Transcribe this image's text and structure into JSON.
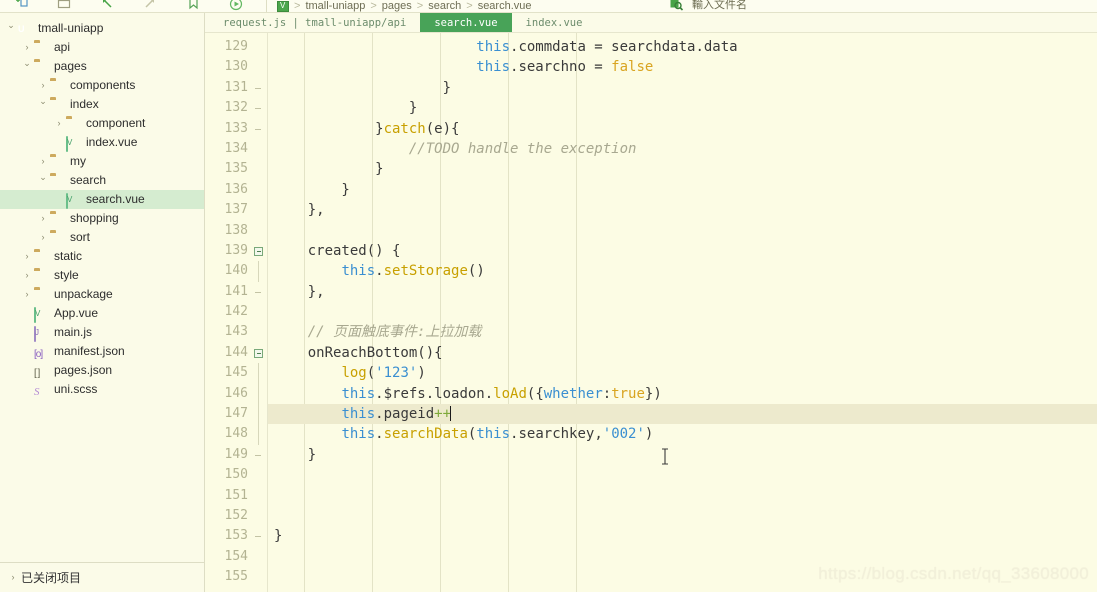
{
  "app": {
    "title": "HBuilderX",
    "watermark": "https://blog.csdn.net/qq_33608000"
  },
  "toolbar": {
    "icons": [
      {
        "name": "new-file-icon",
        "glyph": "+"
      },
      {
        "name": "folder-icon",
        "glyph": "▭"
      },
      {
        "name": "undo-icon",
        "glyph": "↰"
      },
      {
        "name": "redo-icon",
        "glyph": "↱"
      },
      {
        "name": "bookmark-icon",
        "glyph": "⚑"
      },
      {
        "name": "run-icon",
        "glyph": "⟳"
      }
    ],
    "breadcrumb": [
      "tmall-uniapp",
      "pages",
      "search",
      "search.vue"
    ],
    "breadcrumb_separator": ">",
    "find_label": "輸入文件名"
  },
  "sidebar": {
    "footer_label": "已关闭项目",
    "tree": [
      {
        "label": "tmall-uniapp",
        "depth": 0,
        "twisty": "open",
        "icon": "project-root-icon",
        "type": "root",
        "selected": false
      },
      {
        "label": "api",
        "depth": 1,
        "twisty": "closed",
        "icon": "folder-icon",
        "type": "folder",
        "selected": false
      },
      {
        "label": "pages",
        "depth": 1,
        "twisty": "open",
        "icon": "folder-icon",
        "type": "folder",
        "selected": false
      },
      {
        "label": "components",
        "depth": 2,
        "twisty": "closed",
        "icon": "folder-icon",
        "type": "folder",
        "selected": false
      },
      {
        "label": "index",
        "depth": 2,
        "twisty": "open",
        "icon": "folder-icon",
        "type": "folder",
        "selected": false
      },
      {
        "label": "component",
        "depth": 3,
        "twisty": "closed",
        "icon": "folder-icon",
        "type": "folder",
        "selected": false
      },
      {
        "label": "index.vue",
        "depth": 3,
        "twisty": "none",
        "icon": "vue-file-icon",
        "type": "vue",
        "selected": false
      },
      {
        "label": "my",
        "depth": 2,
        "twisty": "closed",
        "icon": "folder-icon",
        "type": "folder",
        "selected": false
      },
      {
        "label": "search",
        "depth": 2,
        "twisty": "open",
        "icon": "folder-icon",
        "type": "folder",
        "selected": false
      },
      {
        "label": "search.vue",
        "depth": 3,
        "twisty": "none",
        "icon": "vue-file-icon",
        "type": "vue",
        "selected": true
      },
      {
        "label": "shopping",
        "depth": 2,
        "twisty": "closed",
        "icon": "folder-icon",
        "type": "folder",
        "selected": false
      },
      {
        "label": "sort",
        "depth": 2,
        "twisty": "closed",
        "icon": "folder-icon",
        "type": "folder",
        "selected": false
      },
      {
        "label": "static",
        "depth": 1,
        "twisty": "closed",
        "icon": "folder-icon",
        "type": "folder",
        "selected": false
      },
      {
        "label": "style",
        "depth": 1,
        "twisty": "closed",
        "icon": "folder-icon",
        "type": "folder",
        "selected": false
      },
      {
        "label": "unpackage",
        "depth": 1,
        "twisty": "closed",
        "icon": "folder-icon",
        "type": "folder",
        "selected": false
      },
      {
        "label": "App.vue",
        "depth": 1,
        "twisty": "none",
        "icon": "vue-file-icon",
        "type": "vue",
        "selected": false
      },
      {
        "label": "main.js",
        "depth": 1,
        "twisty": "none",
        "icon": "js-file-icon",
        "type": "js",
        "selected": false
      },
      {
        "label": "manifest.json",
        "depth": 1,
        "twisty": "none",
        "icon": "json-object-icon",
        "type": "obj",
        "selected": false
      },
      {
        "label": "pages.json",
        "depth": 1,
        "twisty": "none",
        "icon": "json-array-icon",
        "type": "arr",
        "selected": false
      },
      {
        "label": "uni.scss",
        "depth": 1,
        "twisty": "none",
        "icon": "scss-file-icon",
        "type": "scss",
        "selected": false
      }
    ]
  },
  "editor": {
    "tabs": [
      {
        "label": "request.js | tmall-uniapp/api",
        "active": false
      },
      {
        "label": "search.vue",
        "active": true
      },
      {
        "label": "index.vue",
        "active": false
      }
    ],
    "active_tab": "search.vue",
    "first_line_number": 129,
    "last_line_number": 155,
    "current_line_number": 147,
    "colors": {
      "background": "#fcfce4",
      "active_tab_bg": "#48a358",
      "selection_row": "#edeacd",
      "gutter_text": "#b3b392",
      "keyword": "#c8a000",
      "this_keyword": "#3a8fd1",
      "string": "#3a8fd1",
      "boolean": "#d9a420",
      "comment": "#a8a890",
      "sidebar_selected": "#d5ecd0"
    },
    "lines": [
      {
        "n": 129,
        "fold": "none",
        "tokens": [
          {
            "t": "                        ",
            "c": "t-punct"
          },
          {
            "t": "this",
            "c": "t-this"
          },
          {
            "t": ".commdata = searchdata.data",
            "c": "t-punct"
          }
        ]
      },
      {
        "n": 130,
        "fold": "none",
        "tokens": [
          {
            "t": "                        ",
            "c": "t-punct"
          },
          {
            "t": "this",
            "c": "t-this"
          },
          {
            "t": ".searchno = ",
            "c": "t-punct"
          },
          {
            "t": "false",
            "c": "t-bool"
          }
        ]
      },
      {
        "n": 131,
        "fold": "dash",
        "tokens": [
          {
            "t": "                    }",
            "c": "t-punct"
          }
        ]
      },
      {
        "n": 132,
        "fold": "dash",
        "tokens": [
          {
            "t": "                }",
            "c": "t-punct"
          }
        ]
      },
      {
        "n": 133,
        "fold": "dash",
        "tokens": [
          {
            "t": "            }",
            "c": "t-punct"
          },
          {
            "t": "catch",
            "c": "t-kw"
          },
          {
            "t": "(e){",
            "c": "t-punct"
          }
        ]
      },
      {
        "n": 134,
        "fold": "none",
        "tokens": [
          {
            "t": "                //TODO handle the exception",
            "c": "t-cmt"
          }
        ]
      },
      {
        "n": 135,
        "fold": "none",
        "tokens": [
          {
            "t": "            }",
            "c": "t-punct"
          }
        ]
      },
      {
        "n": 136,
        "fold": "none",
        "tokens": [
          {
            "t": "        }",
            "c": "t-punct"
          }
        ]
      },
      {
        "n": 137,
        "fold": "none",
        "tokens": [
          {
            "t": "    },",
            "c": "t-punct"
          }
        ]
      },
      {
        "n": 138,
        "fold": "none",
        "tokens": [
          {
            "t": "",
            "c": "t-punct"
          }
        ]
      },
      {
        "n": 139,
        "fold": "box",
        "tokens": [
          {
            "t": "    created() {",
            "c": "t-punct"
          }
        ]
      },
      {
        "n": 140,
        "fold": "line",
        "tokens": [
          {
            "t": "        ",
            "c": "t-punct"
          },
          {
            "t": "this",
            "c": "t-this"
          },
          {
            "t": ".",
            "c": "t-punct"
          },
          {
            "t": "setStorage",
            "c": "t-kw"
          },
          {
            "t": "()",
            "c": "t-punct"
          }
        ]
      },
      {
        "n": 141,
        "fold": "dash",
        "tokens": [
          {
            "t": "    },",
            "c": "t-punct"
          }
        ]
      },
      {
        "n": 142,
        "fold": "none",
        "tokens": [
          {
            "t": "",
            "c": "t-punct"
          }
        ]
      },
      {
        "n": 143,
        "fold": "none",
        "tokens": [
          {
            "t": "    // 页面触底事件:上拉加载",
            "c": "t-cmt"
          }
        ]
      },
      {
        "n": 144,
        "fold": "box",
        "tokens": [
          {
            "t": "    onReachBottom(){",
            "c": "t-punct"
          }
        ]
      },
      {
        "n": 145,
        "fold": "line",
        "tokens": [
          {
            "t": "        ",
            "c": "t-punct"
          },
          {
            "t": "log",
            "c": "t-kw"
          },
          {
            "t": "(",
            "c": "t-punct"
          },
          {
            "t": "'123'",
            "c": "t-str"
          },
          {
            "t": ")",
            "c": "t-punct"
          }
        ]
      },
      {
        "n": 146,
        "fold": "line",
        "tokens": [
          {
            "t": "        ",
            "c": "t-punct"
          },
          {
            "t": "this",
            "c": "t-this"
          },
          {
            "t": ".$refs.loadon.",
            "c": "t-punct"
          },
          {
            "t": "loAd",
            "c": "t-kw"
          },
          {
            "t": "({",
            "c": "t-punct"
          },
          {
            "t": "whether",
            "c": "t-this"
          },
          {
            "t": ":",
            "c": "t-punct"
          },
          {
            "t": "true",
            "c": "t-bool"
          },
          {
            "t": "})",
            "c": "t-punct"
          }
        ]
      },
      {
        "n": 147,
        "fold": "line",
        "current": true,
        "tokens": [
          {
            "t": "        ",
            "c": "t-punct"
          },
          {
            "t": "this",
            "c": "t-this"
          },
          {
            "t": ".pageid",
            "c": "t-punct"
          },
          {
            "t": "++",
            "c": "t-green"
          }
        ],
        "caret": true
      },
      {
        "n": 148,
        "fold": "line",
        "tokens": [
          {
            "t": "        ",
            "c": "t-punct"
          },
          {
            "t": "this",
            "c": "t-this"
          },
          {
            "t": ".",
            "c": "t-punct"
          },
          {
            "t": "searchData",
            "c": "t-kw"
          },
          {
            "t": "(",
            "c": "t-punct"
          },
          {
            "t": "this",
            "c": "t-this"
          },
          {
            "t": ".searchkey,",
            "c": "t-punct"
          },
          {
            "t": "'002'",
            "c": "t-str"
          },
          {
            "t": ")",
            "c": "t-punct"
          }
        ]
      },
      {
        "n": 149,
        "fold": "dash",
        "tokens": [
          {
            "t": "    }",
            "c": "t-punct"
          }
        ]
      },
      {
        "n": 150,
        "fold": "none",
        "tokens": [
          {
            "t": "",
            "c": "t-punct"
          }
        ]
      },
      {
        "n": 151,
        "fold": "none",
        "tokens": [
          {
            "t": "",
            "c": "t-punct"
          }
        ]
      },
      {
        "n": 152,
        "fold": "none",
        "tokens": [
          {
            "t": "",
            "c": "t-punct"
          }
        ]
      },
      {
        "n": 153,
        "fold": "dash",
        "tokens": [
          {
            "t": "}",
            "c": "t-punct"
          }
        ]
      },
      {
        "n": 154,
        "fold": "none",
        "tokens": [
          {
            "t": "",
            "c": "t-punct"
          }
        ]
      },
      {
        "n": 155,
        "fold": "none",
        "tokens": [
          {
            "t": "",
            "c": "t-punct"
          }
        ]
      }
    ]
  }
}
